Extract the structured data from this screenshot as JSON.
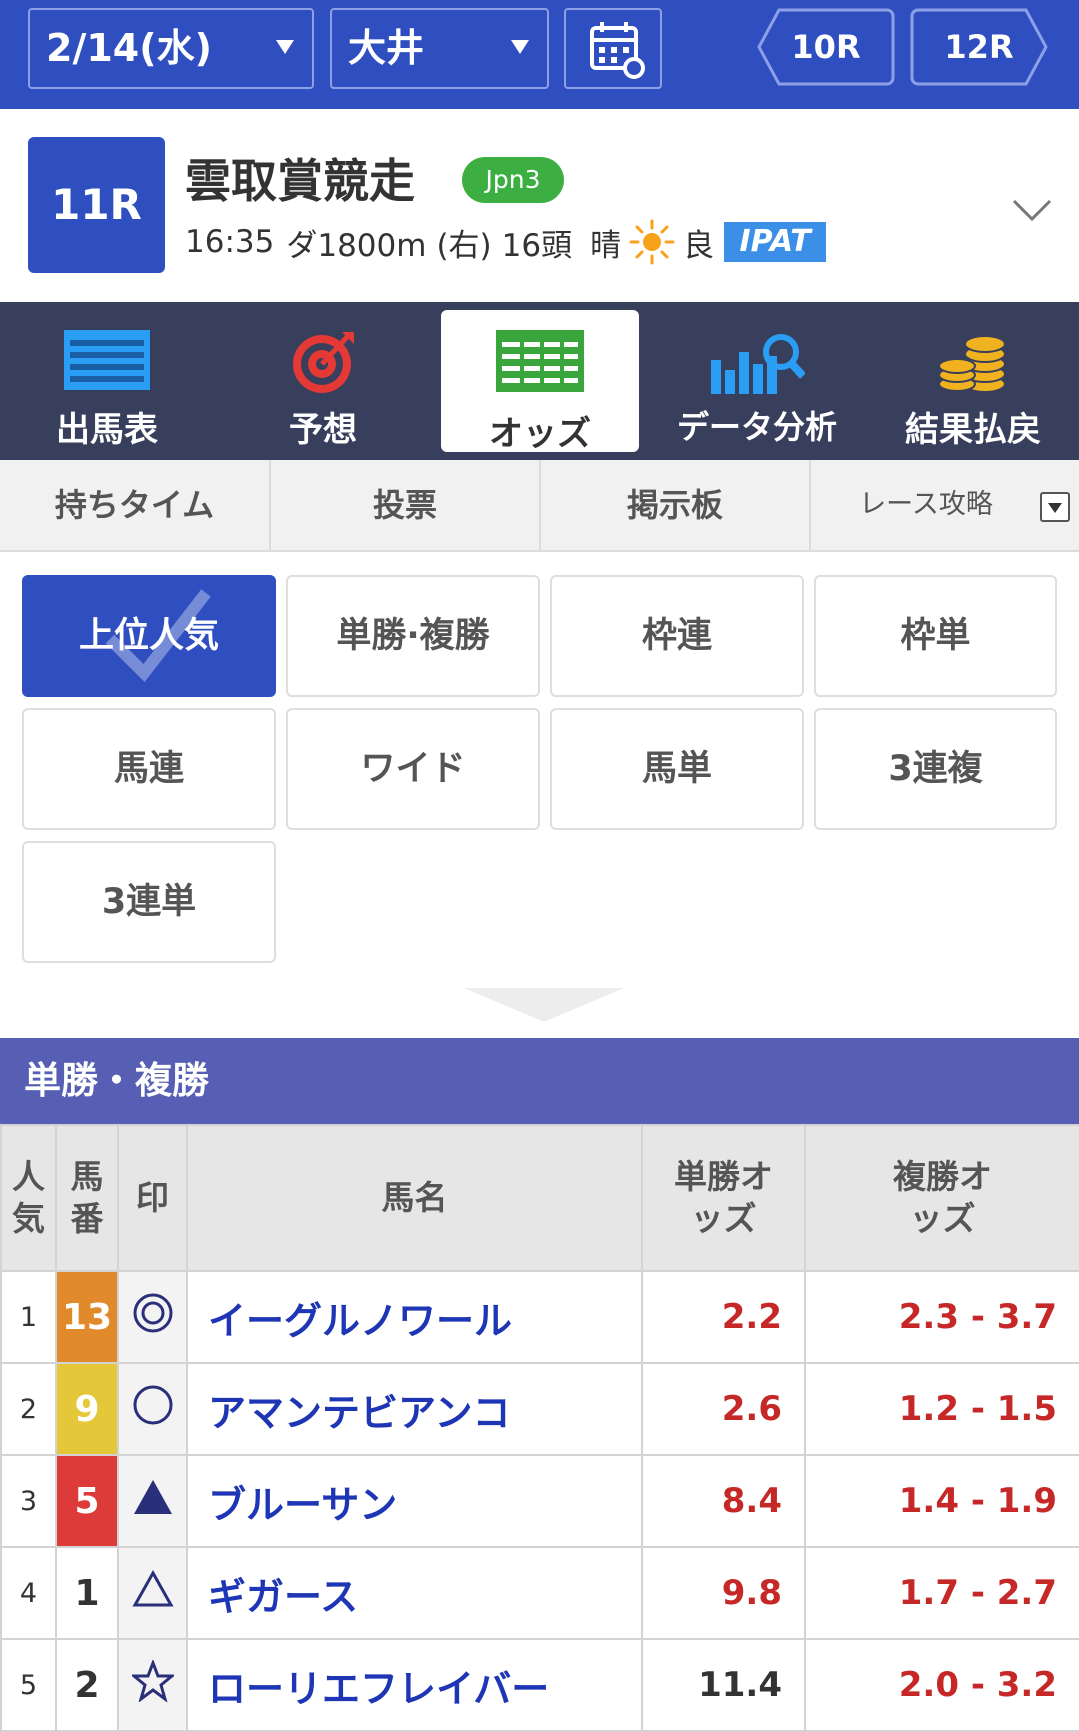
{
  "topbar": {
    "date": "2/14(水)",
    "track": "大井",
    "prev_race": "10R",
    "next_race": "12R",
    "accent": "#2f4fc0"
  },
  "race": {
    "number": "11R",
    "name": "雲取賞競走",
    "grade": "Jpn3",
    "time": "16:35",
    "course": "ダ1800m",
    "direction": "(右)",
    "runners": "16頭",
    "weather": "晴",
    "weather_icon": "sun-icon",
    "going": "良",
    "ipat": "IPAT"
  },
  "main_nav": [
    {
      "label": "出馬表",
      "icon": "race-card-icon"
    },
    {
      "label": "予想",
      "icon": "target-icon"
    },
    {
      "label": "オッズ",
      "icon": "odds-table-icon",
      "active": true
    },
    {
      "label": "データ分析",
      "icon": "data-analysis-icon"
    },
    {
      "label": "結果払戻",
      "icon": "coins-icon"
    }
  ],
  "sub_tabs": [
    "持ちタイム",
    "投票",
    "掲示板",
    "レース攻略"
  ],
  "bet_types": [
    {
      "label": "上位人気",
      "active": true
    },
    {
      "label": "単勝·複勝"
    },
    {
      "label": "枠連"
    },
    {
      "label": "枠単"
    },
    {
      "label": "馬連"
    },
    {
      "label": "ワイド"
    },
    {
      "label": "馬単"
    },
    {
      "label": "3連複"
    },
    {
      "label": "3連単"
    }
  ],
  "section_title": "単勝・複勝",
  "table": {
    "headers": {
      "rank": "人気",
      "umaban": "馬番",
      "mark": "印",
      "name": "馬名",
      "win": "単勝オッズ",
      "place": "複勝オッズ"
    },
    "rows": [
      {
        "rank": "1",
        "umaban": "13",
        "frame_color": "#e08a2c",
        "mark": "double-circle-icon",
        "name": "イーグルノワール",
        "win": "2.2",
        "place": "2.3 - 3.7"
      },
      {
        "rank": "2",
        "umaban": "9",
        "frame_color": "#e5c73a",
        "mark": "circle-icon",
        "name": "アマンテビアンコ",
        "win": "2.6",
        "place": "1.2 - 1.5"
      },
      {
        "rank": "3",
        "umaban": "5",
        "frame_color": "#dd3a3a",
        "mark": "filled-triangle-icon",
        "name": "ブルーサン",
        "win": "8.4",
        "place": "1.4 - 1.9"
      },
      {
        "rank": "4",
        "umaban": "1",
        "frame_color": "#ffffff",
        "mark": "triangle-icon",
        "name": "ギガース",
        "win": "9.8",
        "place": "1.7 - 2.7"
      },
      {
        "rank": "5",
        "umaban": "2",
        "frame_color": "#ffffff",
        "mark": "star-icon",
        "name": "ローリエフレイバー",
        "win": "11.4",
        "place": "2.0 - 3.2"
      }
    ]
  }
}
